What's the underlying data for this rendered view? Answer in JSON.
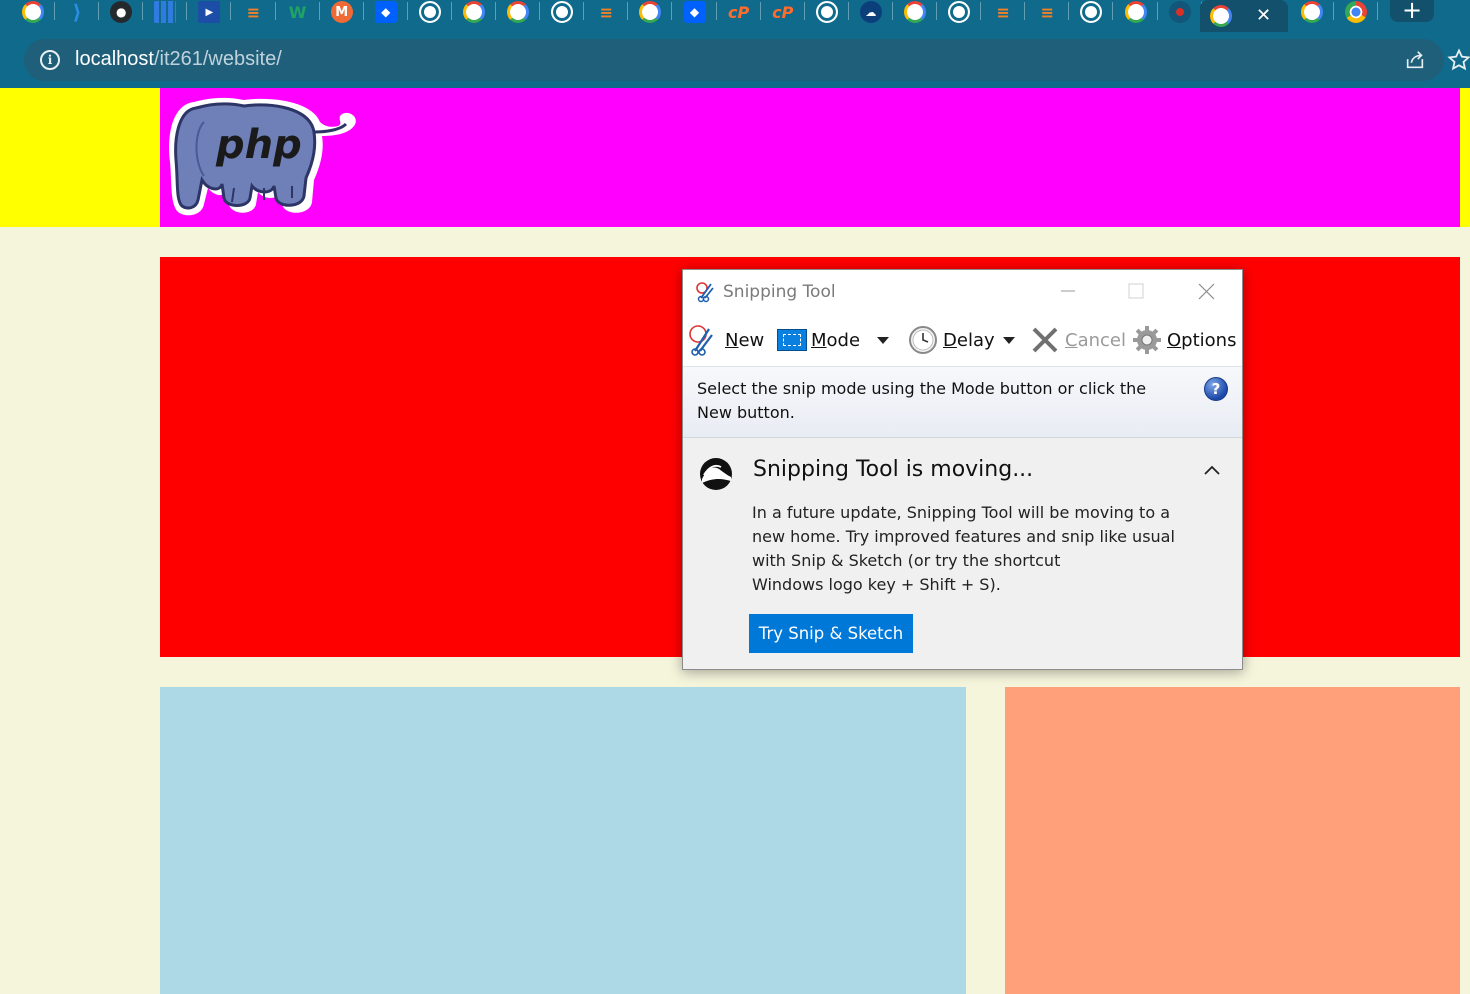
{
  "browser": {
    "tab_icons": [
      "google-icon",
      "vscode-icon",
      "github-icon",
      "grid-icon",
      "play-icon",
      "stackoverflow-icon",
      "w-icon",
      "m-icon",
      "dropbox-icon",
      "globe-icon",
      "google-icon",
      "google-icon",
      "globe-icon",
      "stackoverflow-icon",
      "google-icon",
      "dropbox-icon",
      "cpanel-icon",
      "cpanel-icon",
      "globe-icon",
      "cloud-icon",
      "google-icon",
      "globe-icon",
      "stackoverflow-icon",
      "stackoverflow-icon",
      "globe-icon",
      "google-icon",
      "record-icon"
    ],
    "active_tab_icon": "google-icon",
    "active_tab_close": "✕",
    "extra_tab_icons": [
      "google-icon",
      "chrome-icon"
    ],
    "new_tab_label": "+",
    "address": {
      "host": "localhost",
      "path": "/it261/website/"
    }
  },
  "page": {
    "colors": {
      "background": "#f5f5dc",
      "yellow": "#ffff00",
      "header": "#ff00ff",
      "red": "#ff0000",
      "blue": "#add8e6",
      "salmon": "#ffa07a"
    },
    "logo_text": "php"
  },
  "snipping_tool": {
    "title": "Snipping Tool",
    "toolbar": {
      "new_label": "New",
      "new_key": "N",
      "mode_label": "Mode",
      "mode_key": "M",
      "delay_label": "Delay",
      "delay_key": "D",
      "cancel_label": "Cancel",
      "cancel_key": "C",
      "options_label": "Options",
      "options_key": "O"
    },
    "info_text": "Select the snip mode using the Mode button or click the New button.",
    "help_glyph": "?",
    "notice": {
      "title": "Snipping Tool is moving...",
      "lines": [
        "In a future update, Snipping Tool will be moving to a",
        "new home. Try improved features and snip like usual",
        "with Snip & Sketch (or try the shortcut",
        "Windows logo key + Shift + S)."
      ],
      "button_label": "Try Snip & Sketch"
    },
    "accent": "#0078d7"
  }
}
